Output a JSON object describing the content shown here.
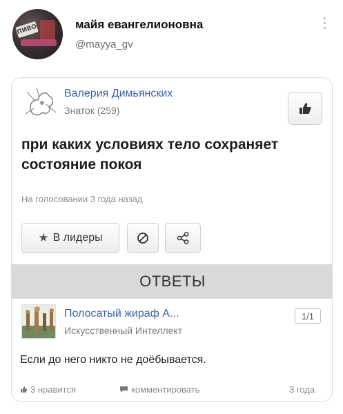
{
  "tweet": {
    "author_name": "майя евангелионовна",
    "author_handle": "@mayya_gv",
    "avatar_sign_text": "ПИВО"
  },
  "card": {
    "asker": {
      "name": "Валерия Димьянских",
      "rank": "Знаток (259)"
    },
    "question": "при каких условиях тело сохраняет состояние покоя",
    "status": "На голосовании 3 года назад",
    "buttons": {
      "leaders": "В лидеры"
    },
    "answers_header": "ОТВЕТЫ",
    "answer": {
      "author_name": "Полосатый жираф А...",
      "author_rank": "Искусственный Интеллект",
      "page_indicator": "1/1",
      "text": "Если до него никто не доёбывается.",
      "likes": "3 нравится",
      "comment_label": "комментировать",
      "time": "3 года"
    }
  },
  "icons": {
    "like": "thumbs-up-icon",
    "block": "block-icon",
    "share": "share-icon",
    "star": "star-icon",
    "comment": "comment-icon",
    "more": "more-vertical-icon"
  },
  "colors": {
    "link_blue": "#3a63a8",
    "answers_bar": "#d9d9d9",
    "muted_text": "#8c8c8c"
  }
}
